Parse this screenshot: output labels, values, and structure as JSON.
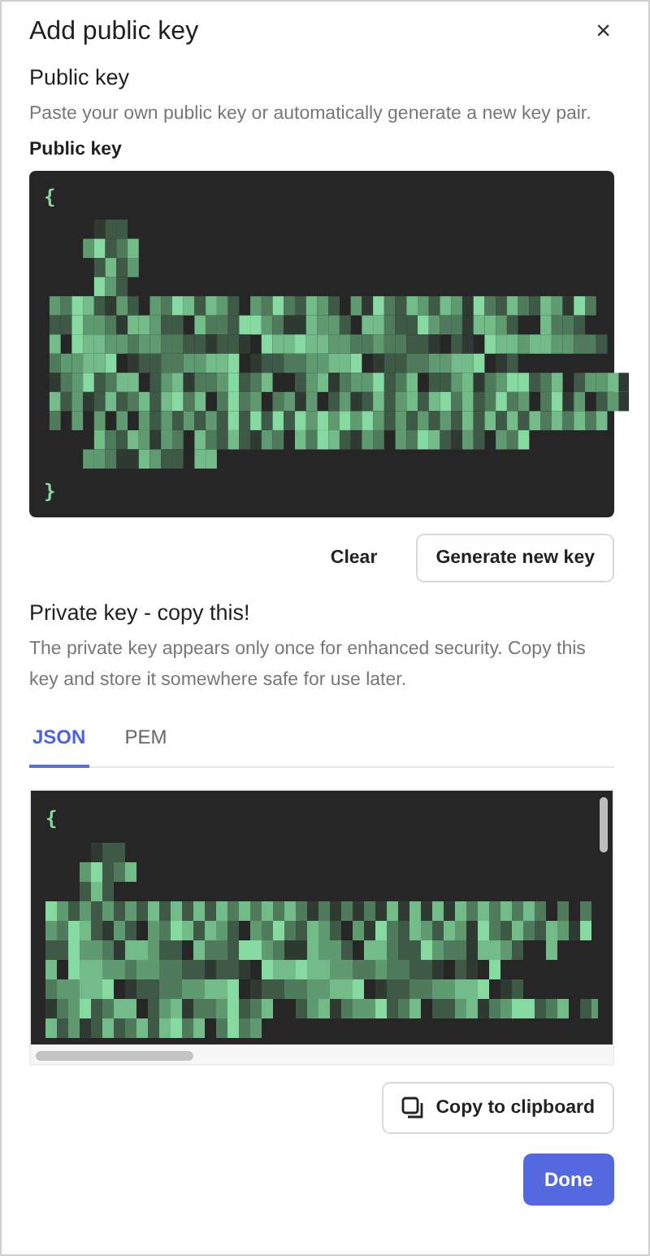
{
  "dialog": {
    "title": "Add public key",
    "close": "×"
  },
  "public_key": {
    "heading": "Public key",
    "description": "Paste your own public key or automatically generate a new key pair.",
    "label": "Public key",
    "open_brace": "{",
    "close_brace": "}"
  },
  "public_actions": [
    "Clear",
    "Generate new key"
  ],
  "private_key": {
    "heading": "Private key - copy this!",
    "description": "The private key appears only once for enhanced security. Copy this key and store it somewhere safe for use later."
  },
  "tabs": [
    {
      "label": "JSON",
      "selected": true
    },
    {
      "label": "PEM",
      "selected": false
    }
  ],
  "private_code": {
    "open_brace": "{"
  },
  "copy_button": "Copy to clipboard",
  "done_button": "Done"
}
